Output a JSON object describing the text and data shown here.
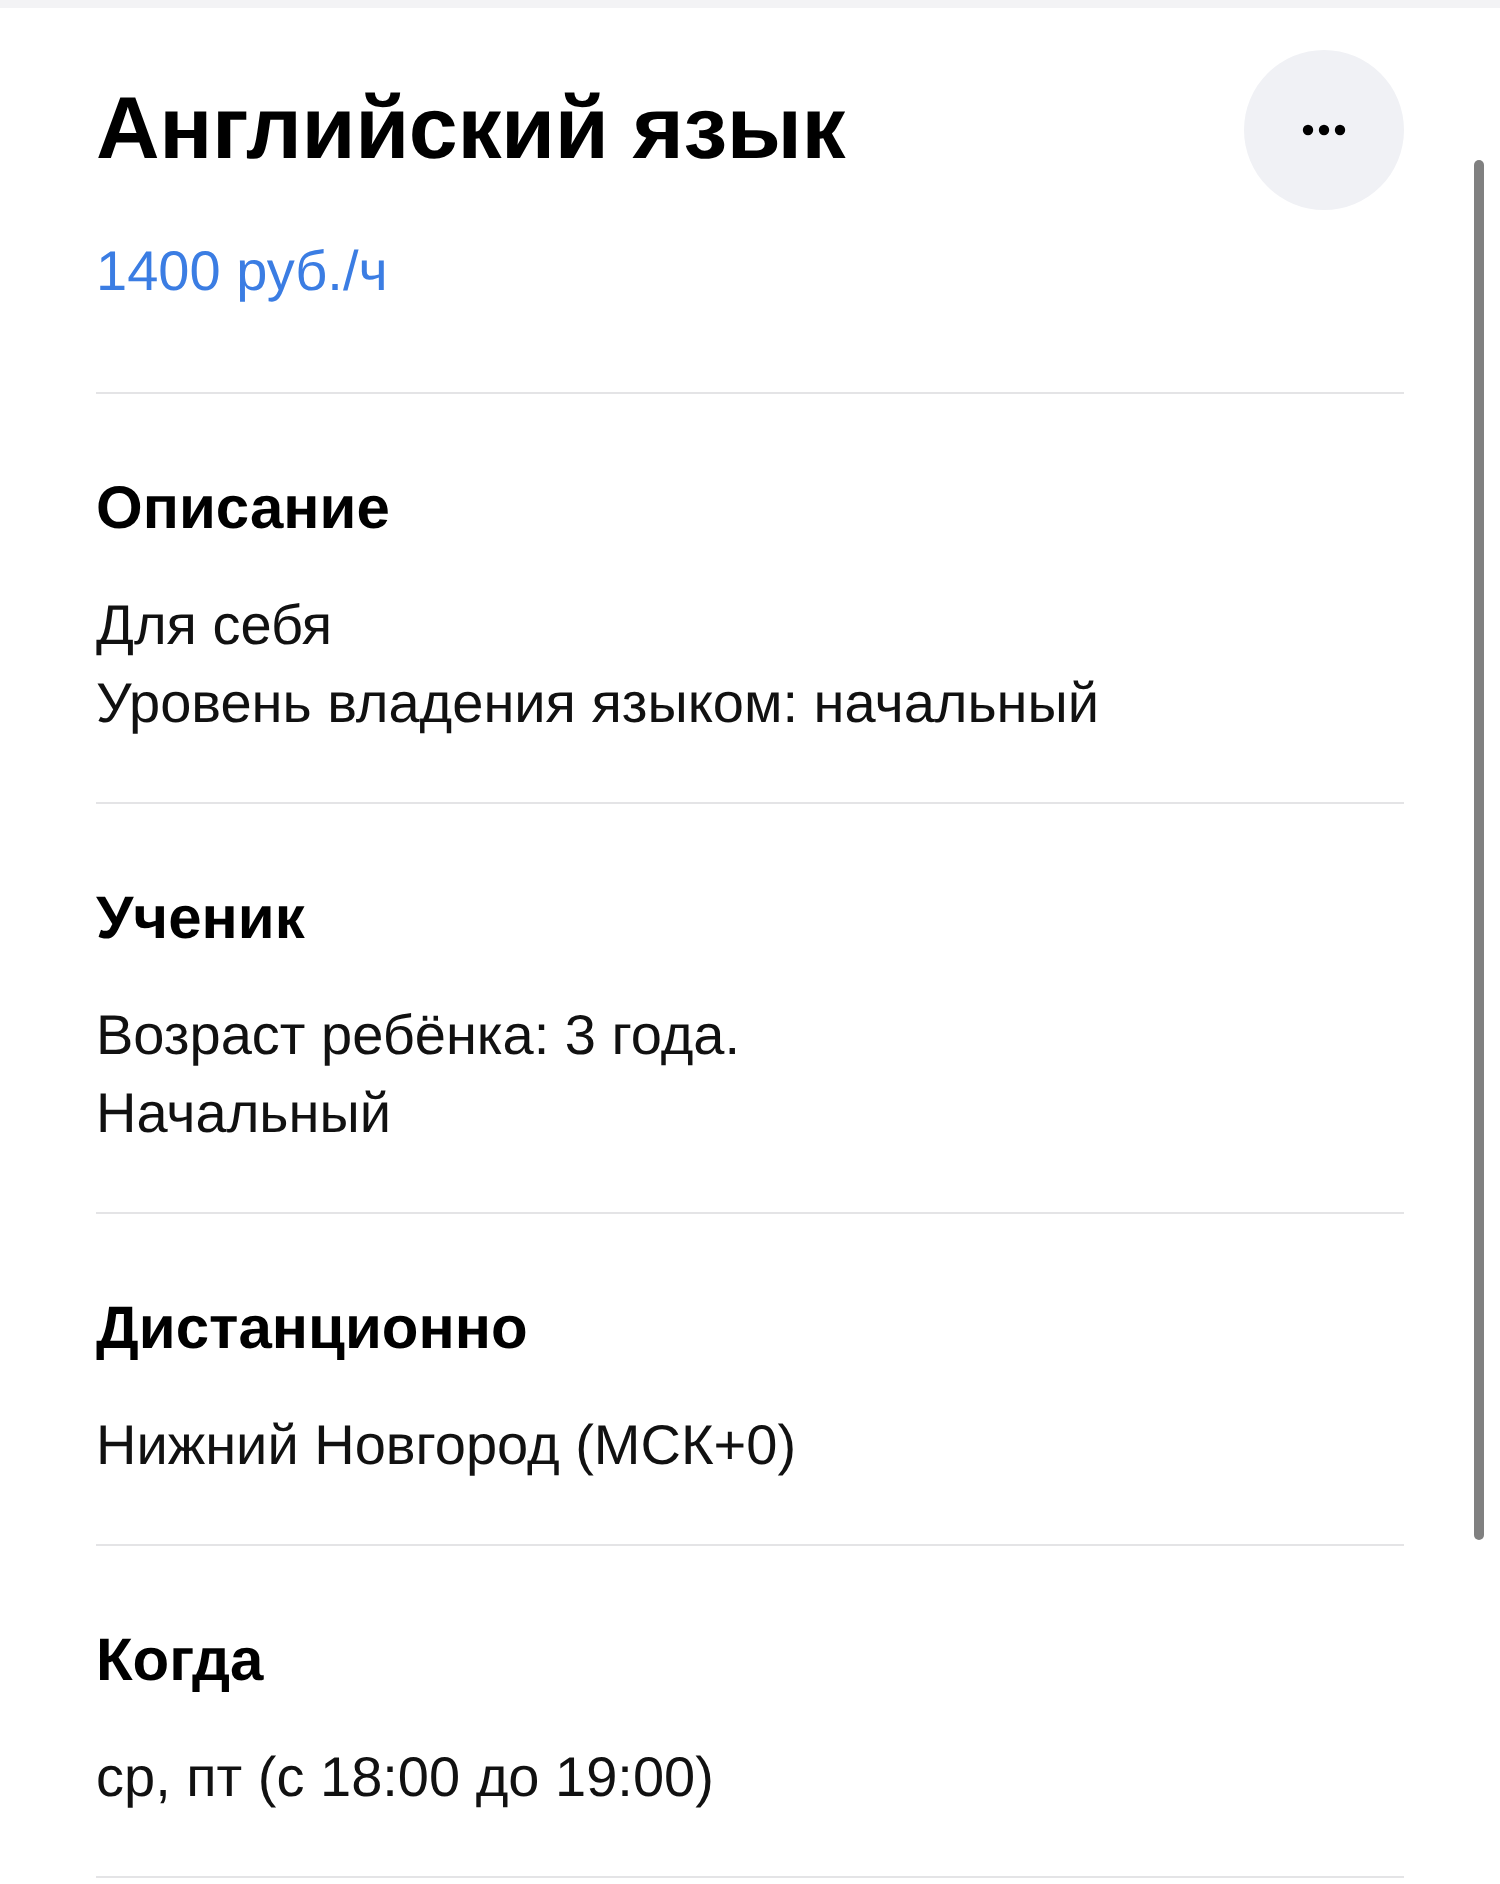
{
  "header": {
    "title": "Английский язык",
    "price": "1400 руб./ч"
  },
  "sections": [
    {
      "heading": "Описание",
      "lines": [
        "Для себя",
        "Уровень владения языком: начальный"
      ]
    },
    {
      "heading": "Ученик",
      "lines": [
        "Возраст ребёнка: 3 года.",
        "Начальный"
      ]
    },
    {
      "heading": "Дистанционно",
      "lines": [
        "Нижний Новгород (МСК+0)"
      ]
    },
    {
      "heading": "Когда",
      "lines": [
        "ср, пт (с 18:00 до 19:00)"
      ]
    }
  ]
}
